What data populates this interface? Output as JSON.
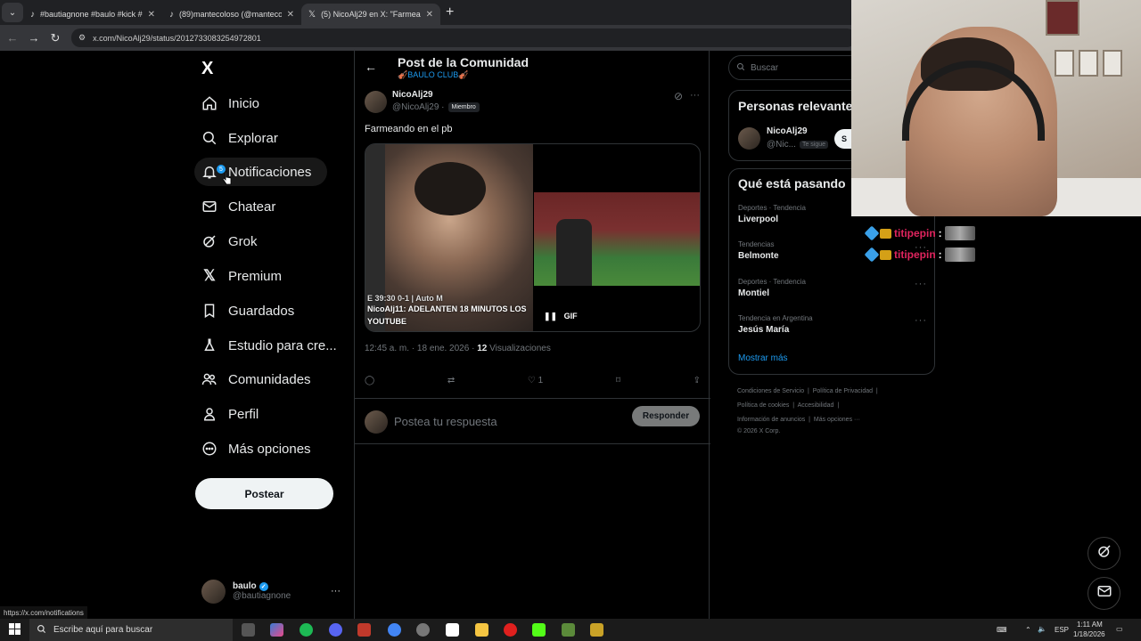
{
  "browser": {
    "tabs": [
      {
        "title": "#bautiagnone #baulo #kick #cl",
        "close": "✕"
      },
      {
        "title": "(89)mantecoloso (@mantecolo",
        "close": "✕"
      },
      {
        "title": "(5) NicoAlj29 en X: \"Farmeando",
        "close": "✕"
      }
    ],
    "new_tab": "+",
    "url": "x.com/NicoAlj29/status/2012733083254972801"
  },
  "sidebar": {
    "logo": "X",
    "items": [
      {
        "label": "Inicio",
        "icon": "home-icon"
      },
      {
        "label": "Explorar",
        "icon": "search-icon"
      },
      {
        "label": "Notificaciones",
        "icon": "bell-icon",
        "badge": "5"
      },
      {
        "label": "Chatear",
        "icon": "mail-icon"
      },
      {
        "label": "Grok",
        "icon": "grok-icon"
      },
      {
        "label": "Premium",
        "icon": "x-icon"
      },
      {
        "label": "Guardados",
        "icon": "bookmark-icon"
      },
      {
        "label": "Estudio para cre...",
        "icon": "flask-icon"
      },
      {
        "label": "Comunidades",
        "icon": "people-icon"
      },
      {
        "label": "Perfil",
        "icon": "person-icon"
      },
      {
        "label": "Más opciones",
        "icon": "more-icon"
      }
    ],
    "post_button": "Postear",
    "account": {
      "name": "baulo",
      "handle": "@bautiagnone",
      "more": "···"
    }
  },
  "post": {
    "header_title": "Post de la Comunidad",
    "header_sub": "🎻BAULO CLUB🎻",
    "author_name": "NicoAlj29",
    "author_handle": "@NicoAlj29 ·",
    "member_badge": "Miembro",
    "text": "Farmeando en el pb",
    "media_overlay": "NicoAlj11: ADELANTEN 18 MINUTOS LOS",
    "media_overlay2": "YOUTUBE",
    "media_overlay3": "E 39:30 0-1 | Auto M",
    "gif_label": "GIF",
    "timestamp": "12:45 a. m. · 18 ene. 2026 ·",
    "views_count": "12",
    "views_label": "Visualizaciones",
    "like_count": "1",
    "reply_placeholder": "Postea tu respuesta",
    "reply_button": "Responder"
  },
  "right": {
    "search_placeholder": "Buscar",
    "relevant_title": "Personas relevante",
    "relevant_person": {
      "name": "NicoAlj29",
      "handle": "@Nic...",
      "follows_you": "Te sigue",
      "follow_btn": "S"
    },
    "trends_title": "Qué está pasando",
    "trends": [
      {
        "meta": "Deportes · Tendencia",
        "name": "Liverpool"
      },
      {
        "meta": "Tendencias",
        "name": "Belmonte"
      },
      {
        "meta": "Deportes · Tendencia",
        "name": "Montiel"
      },
      {
        "meta": "Tendencia en Argentina",
        "name": "Jesús María"
      }
    ],
    "show_more": "Mostrar más",
    "footer": [
      "Condiciones de Servicio",
      "Política de Privacidad",
      "Política de cookies",
      "Accesibilidad",
      "Información de anuncios",
      "Más opciones ···",
      "© 2026 X Corp."
    ]
  },
  "chat_overlay": [
    {
      "user": "titipepin",
      "sep": ":"
    },
    {
      "user": "titipepin",
      "sep": ":"
    }
  ],
  "status_url": "https://x.com/notifications",
  "taskbar": {
    "search_placeholder": "Escribe aquí para buscar",
    "lang": "ESP",
    "time": "1:11 AM",
    "date": "1/18/2026"
  }
}
